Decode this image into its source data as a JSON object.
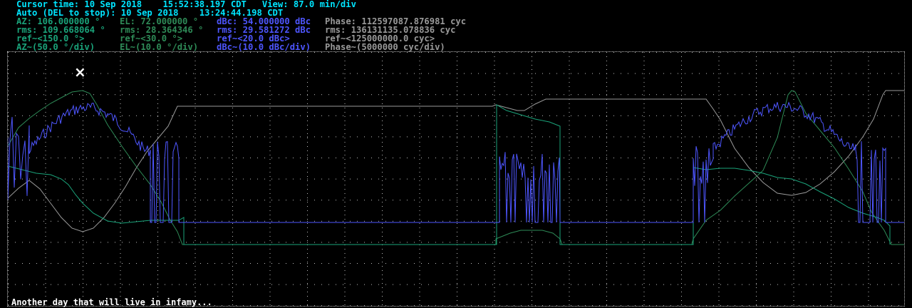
{
  "colors": {
    "cyan": "#00e5ff",
    "az_green": "#1aa37a",
    "el_green": "#2e8b57",
    "blue": "#4e56ff",
    "gray": "#9a9a9a",
    "white": "#ffffff",
    "grid": "#b8b8b8"
  },
  "header": {
    "line1": "Cursor time: 10 Sep 2018    15:52:38.197 CDT   View: 87.0 min/div",
    "line2": "Auto (DEL to stop): 10 Sep 2018    13:24:44.198 CDT",
    "az_value": "AZ: 106.000000 °",
    "el_value": "EL: 72.000000 °",
    "dbc_value": "dBc: 54.000000 dBc",
    "phase_value": "Phase: 112597087.876981 cyc",
    "az_rms": "rms: 109.668064 °",
    "el_rms": "rms: 28.364346 °",
    "dbc_rms": "rms: 29.581272 dBc",
    "phase_rms": "rms: 136131135.078836 cyc",
    "az_ref": "ref~<150.0 °>",
    "el_ref": "ref~<30.0 °>",
    "dbc_ref": "ref~<20.0 dBc>",
    "phase_ref": "ref~<125000000.0 cyc>",
    "az_scale": "AZ~(50.0 °/div)",
    "el_scale": "EL~(10.0 °/div)",
    "dbc_scale": "dBc~(10.0 dBc/div)",
    "phase_scale": "Phase~(5000000 cyc/div)"
  },
  "plot": {
    "cursor_symbol": "×",
    "message": "Another day that will live in infamy..."
  }
}
